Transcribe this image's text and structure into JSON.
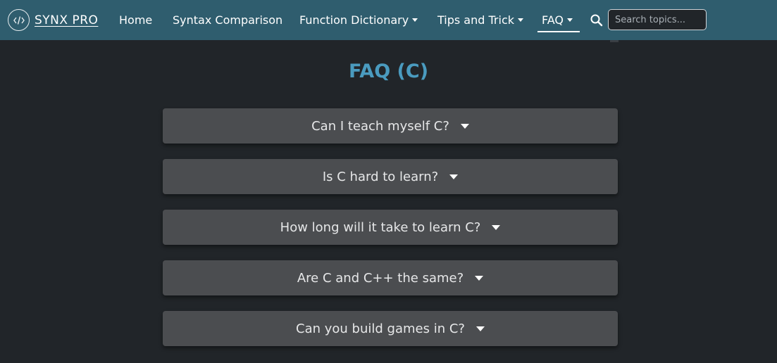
{
  "brand": {
    "name": "SYNX PRO",
    "logo_icon": "code-icon"
  },
  "nav": {
    "items": [
      {
        "label": "Home",
        "dropdown": false
      },
      {
        "label": "Syntax Comparison",
        "dropdown": false
      },
      {
        "label": "Function Dictionary",
        "dropdown": true
      },
      {
        "label": "Tips and Trick",
        "dropdown": true
      },
      {
        "label": "FAQ",
        "dropdown": true,
        "active": true
      }
    ],
    "search_icon": "search-icon",
    "search_placeholder": "Search topics..."
  },
  "page": {
    "title": "FAQ (C)",
    "faqs": [
      {
        "question": "Can I teach myself C?"
      },
      {
        "question": "Is C hard to learn?"
      },
      {
        "question": "How long will it take to learn C?"
      },
      {
        "question": "Are C and C++ the same?"
      },
      {
        "question": "Can you build games in C?"
      }
    ]
  },
  "colors": {
    "navbar": "#2f5d6e",
    "background": "#212529",
    "title": "#4a9bbf",
    "faq_card": "#4b4d50"
  }
}
